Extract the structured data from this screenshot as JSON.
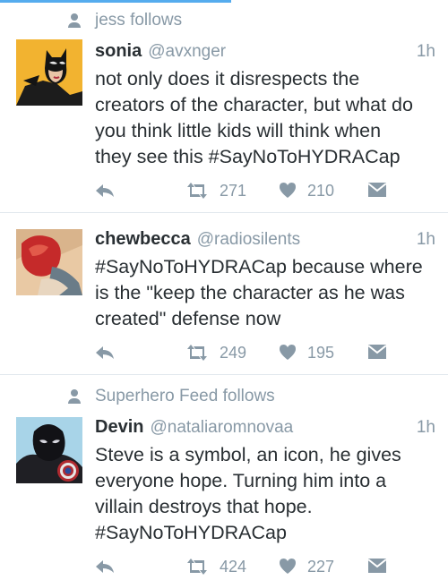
{
  "colors": {
    "accent": "#55acee",
    "icon_gray": "#8899a6",
    "text": "#292f33",
    "divider": "#e1e8ed"
  },
  "tweets": [
    {
      "context": "jess follows",
      "name": "sonia",
      "handle": "@avxnger",
      "time": "1h",
      "text": "not only does it disrespects the\ncreators of the character, but what do\nyou think little kids will think when\nthey see this #SayNoToHYDRACap",
      "retweets": "271",
      "likes": "210",
      "icons": [
        "reply-icon",
        "retweet-icon",
        "heart-icon",
        "direct-message-icon"
      ]
    },
    {
      "context": "",
      "name": "chewbecca",
      "handle": "@radiosilents",
      "time": "1h",
      "text": "#SayNoToHYDRACap because where\nis the \"keep the character as he was\ncreated\" defense now",
      "retweets": "249",
      "likes": "195",
      "icons": [
        "reply-icon",
        "retweet-icon",
        "heart-icon",
        "direct-message-icon"
      ]
    },
    {
      "context": "Superhero Feed follows",
      "name": "Devin",
      "handle": "@nataliaromnovaa",
      "time": "1h",
      "text": "Steve is a symbol, an icon, he gives\neveryone hope. Turning him into a\nvillain destroys that hope.\n#SayNoToHYDRACap",
      "retweets": "424",
      "likes": "227",
      "icons": [
        "reply-icon",
        "retweet-icon",
        "heart-icon",
        "direct-message-icon"
      ]
    }
  ]
}
